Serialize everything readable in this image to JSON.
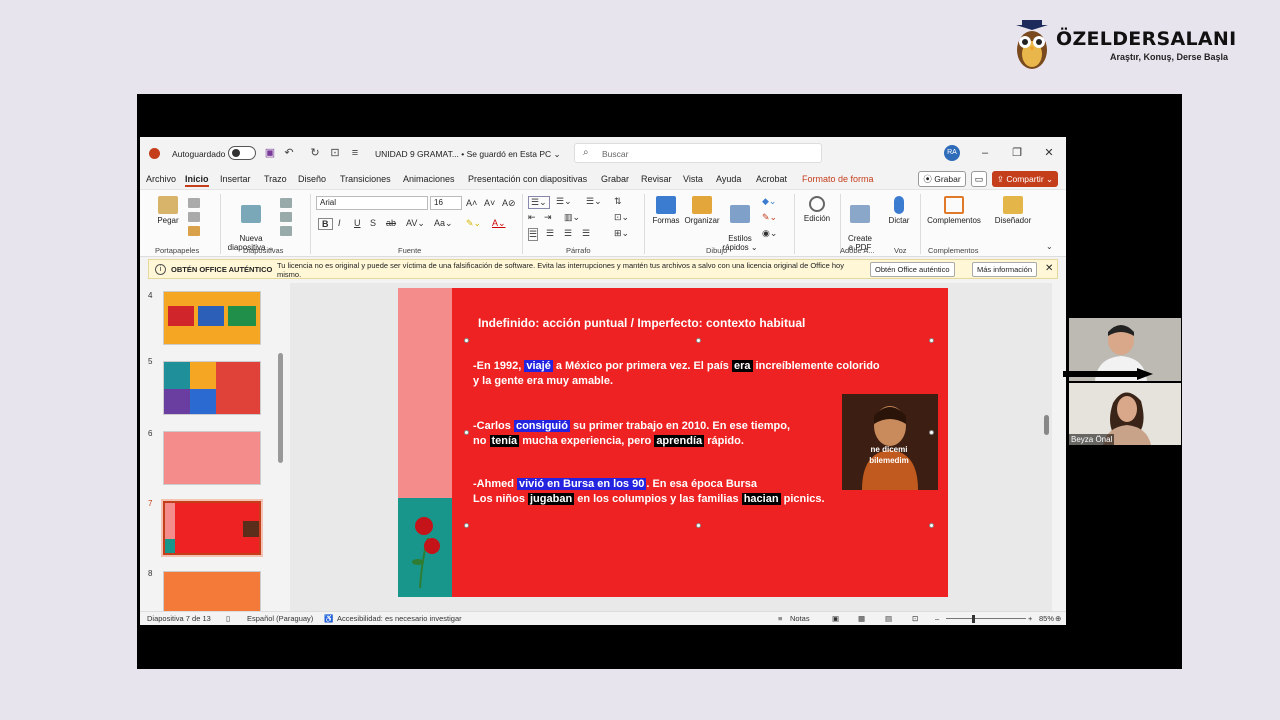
{
  "brand": {
    "name": "ÖZELDERSALANI",
    "tagline": "Araştır, Konuş, Derse Başla"
  },
  "window": {
    "autosave_label": "Autoguardado",
    "doc_title": "UNIDAD  9 GRAMAT...  •  Se guardó en Esta PC ⌄",
    "search_placeholder": "Buscar",
    "avatar": "RA"
  },
  "menu": {
    "tabs": [
      "Archivo",
      "Inicio",
      "Insertar",
      "Trazo",
      "Diseño",
      "Transiciones",
      "Animaciones",
      "Presentación con diapositivas",
      "Grabar",
      "Revisar",
      "Vista",
      "Ayuda",
      "Acrobat",
      "Formato de forma"
    ],
    "record": "Grabar",
    "share": "Compartir"
  },
  "ribbon": {
    "paste": "Pegar",
    "new_slide": "Nueva\ndiapositiva ⌄",
    "font_name": "Arial",
    "font_size": "16",
    "shapes": "Formas",
    "arrange": "Organizar",
    "quick_styles": "Estilos\nrápidos ⌄",
    "editing": "Edición",
    "create_pdf": "Create\na PDF",
    "dictate": "Dictar",
    "addins": "Complementos",
    "designer": "Diseñador",
    "groups": [
      "Portapapeles",
      "Diapositivas",
      "Fuente",
      "Párrafo",
      "Dibujo",
      "Adobe A...",
      "Voz",
      "Complementos"
    ]
  },
  "notice": {
    "title": "OBTÉN OFFICE AUTÉNTICO",
    "text": "Tu licencia no es original y puede ser víctima de una falsificación de software. Evita las interrupciones y mantén tus archivos a salvo con una licencia original de Office hoy mismo.",
    "btn_get": "Obtén Office auténtico",
    "btn_more": "Más información"
  },
  "thumbnails": [
    {
      "num": "4",
      "color": "#f5a623"
    },
    {
      "num": "5",
      "color": "#f26b3a"
    },
    {
      "num": "6",
      "color": "#f48c8c"
    },
    {
      "num": "7",
      "color": "#ee2222"
    },
    {
      "num": "8",
      "color": "#f47a3a"
    }
  ],
  "slide": {
    "title": "Indefinido: acción puntual / Imperfecto: contexto habitual",
    "p1_a": "-En 1992, ",
    "p1_hl1": "viajé",
    "p1_b": " a México por primera vez. El país ",
    "p1_hl2": "era",
    "p1_c": " increíblemente colorido",
    "p1_line2": " y la gente era muy amable.",
    "p2_a": "-Carlos ",
    "p2_hl1": "consiguió",
    "p2_b": " su primer trabajo en 2010. En ese tiempo,",
    "p2_c": "no ",
    "p2_hl2": "tenía",
    "p2_d": " mucha experiencia, pero ",
    "p2_hl3": "aprendía",
    "p2_e": " rápido.",
    "p3_a": "-Ahmed  ",
    "p3_hl1": "vivió   en Bursa en los 90",
    "p3_b": ".  En esa época  Bursa",
    "p3_c": "Los niños ",
    "p3_hl2": "jugaban",
    "p3_d": " en los columpios y las familias ",
    "p3_hl3": "hacian",
    "p3_e": " picnics.",
    "photo_caption": "ne dicemi\nbilemedim"
  },
  "status": {
    "slide_count": "Diapositiva 7 de 13",
    "language": "Español (Paraguay)",
    "accessibility": "Accesibilidad: es necesario investigar",
    "notes": "Notas",
    "zoom": "85%"
  },
  "participants": [
    {
      "name": ""
    },
    {
      "name": "Beyza Önal"
    }
  ]
}
